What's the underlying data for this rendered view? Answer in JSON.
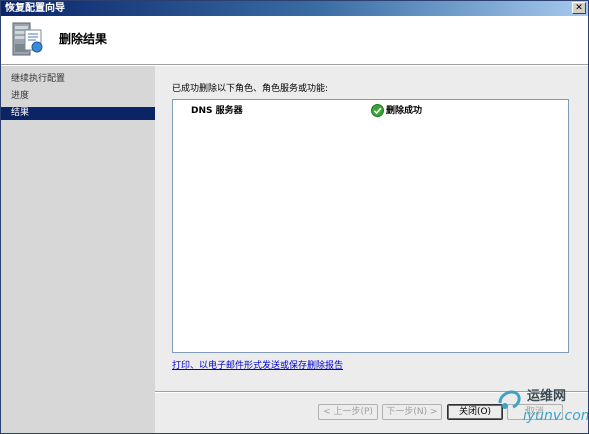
{
  "window": {
    "title": "恢复配置向导",
    "close_glyph": "✕"
  },
  "header": {
    "heading": "删除结果",
    "icon": "server-wizard-icon"
  },
  "sidebar": {
    "items": [
      {
        "label": "继续执行配置",
        "active": false
      },
      {
        "label": "进度",
        "active": false
      },
      {
        "label": "结果",
        "active": true
      }
    ]
  },
  "main": {
    "description": "已成功删除以下角色、角色服务或功能:",
    "results": [
      {
        "role": "DNS 服务器",
        "status": "删除成功",
        "status_icon": "success-check-icon"
      }
    ],
    "report_link": "打印、以电子邮件形式发送或保存删除报告"
  },
  "buttons": {
    "prev": "< 上一步(P)",
    "next": "下一步(N) >",
    "close": "关闭(O)",
    "cancel": "取消"
  },
  "watermark": {
    "cn": "运维网",
    "en": "iyunv.com"
  },
  "colors": {
    "titlebar_start": "#0a246a",
    "sidebar_bg": "#d7d7d7",
    "sidebar_active": "#0b2465",
    "content_bg": "#ececec",
    "link": "#0000cc",
    "success": "#3aa63a"
  }
}
